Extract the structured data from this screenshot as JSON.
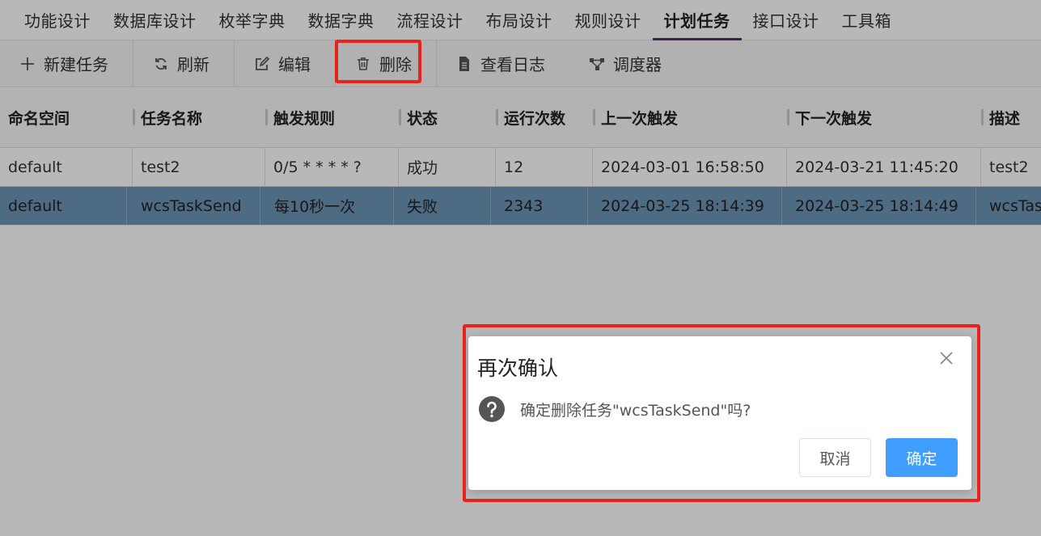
{
  "nav": {
    "items": [
      "功能设计",
      "数据库设计",
      "枚举字典",
      "数据字典",
      "流程设计",
      "布局设计",
      "规则设计",
      "计划任务",
      "接口设计",
      "工具箱"
    ],
    "active_index": 7
  },
  "toolbar": {
    "new_task": "新建任务",
    "refresh": "刷新",
    "edit": "编辑",
    "delete": "删除",
    "view_log": "查看日志",
    "scheduler": "调度器"
  },
  "table": {
    "columns": [
      "命名空间",
      "任务名称",
      "触发规则",
      "状态",
      "运行次数",
      "上一次触发",
      "下一次触发",
      "描述"
    ],
    "rows": [
      [
        "default",
        "test2",
        "0/5 * * * * ?",
        "成功",
        "12",
        "2024-03-01 16:58:50",
        "2024-03-21 11:45:20",
        "test2"
      ],
      [
        "default",
        "wcsTaskSend",
        "每10秒一次",
        "失败",
        "2343",
        "2024-03-25 18:14:39",
        "2024-03-25 18:14:49",
        "wcsTaskSend"
      ]
    ],
    "selected_row": 1
  },
  "dialog": {
    "title": "再次确认",
    "message": "确定删除任务\"wcsTaskSend\"吗?",
    "cancel_label": "取消",
    "confirm_label": "确定"
  },
  "colors": {
    "accent_nav": "#5a2d6e",
    "selected_row": "#6d95b8",
    "primary_button": "#409eff",
    "highlight_box": "#e8231b"
  }
}
